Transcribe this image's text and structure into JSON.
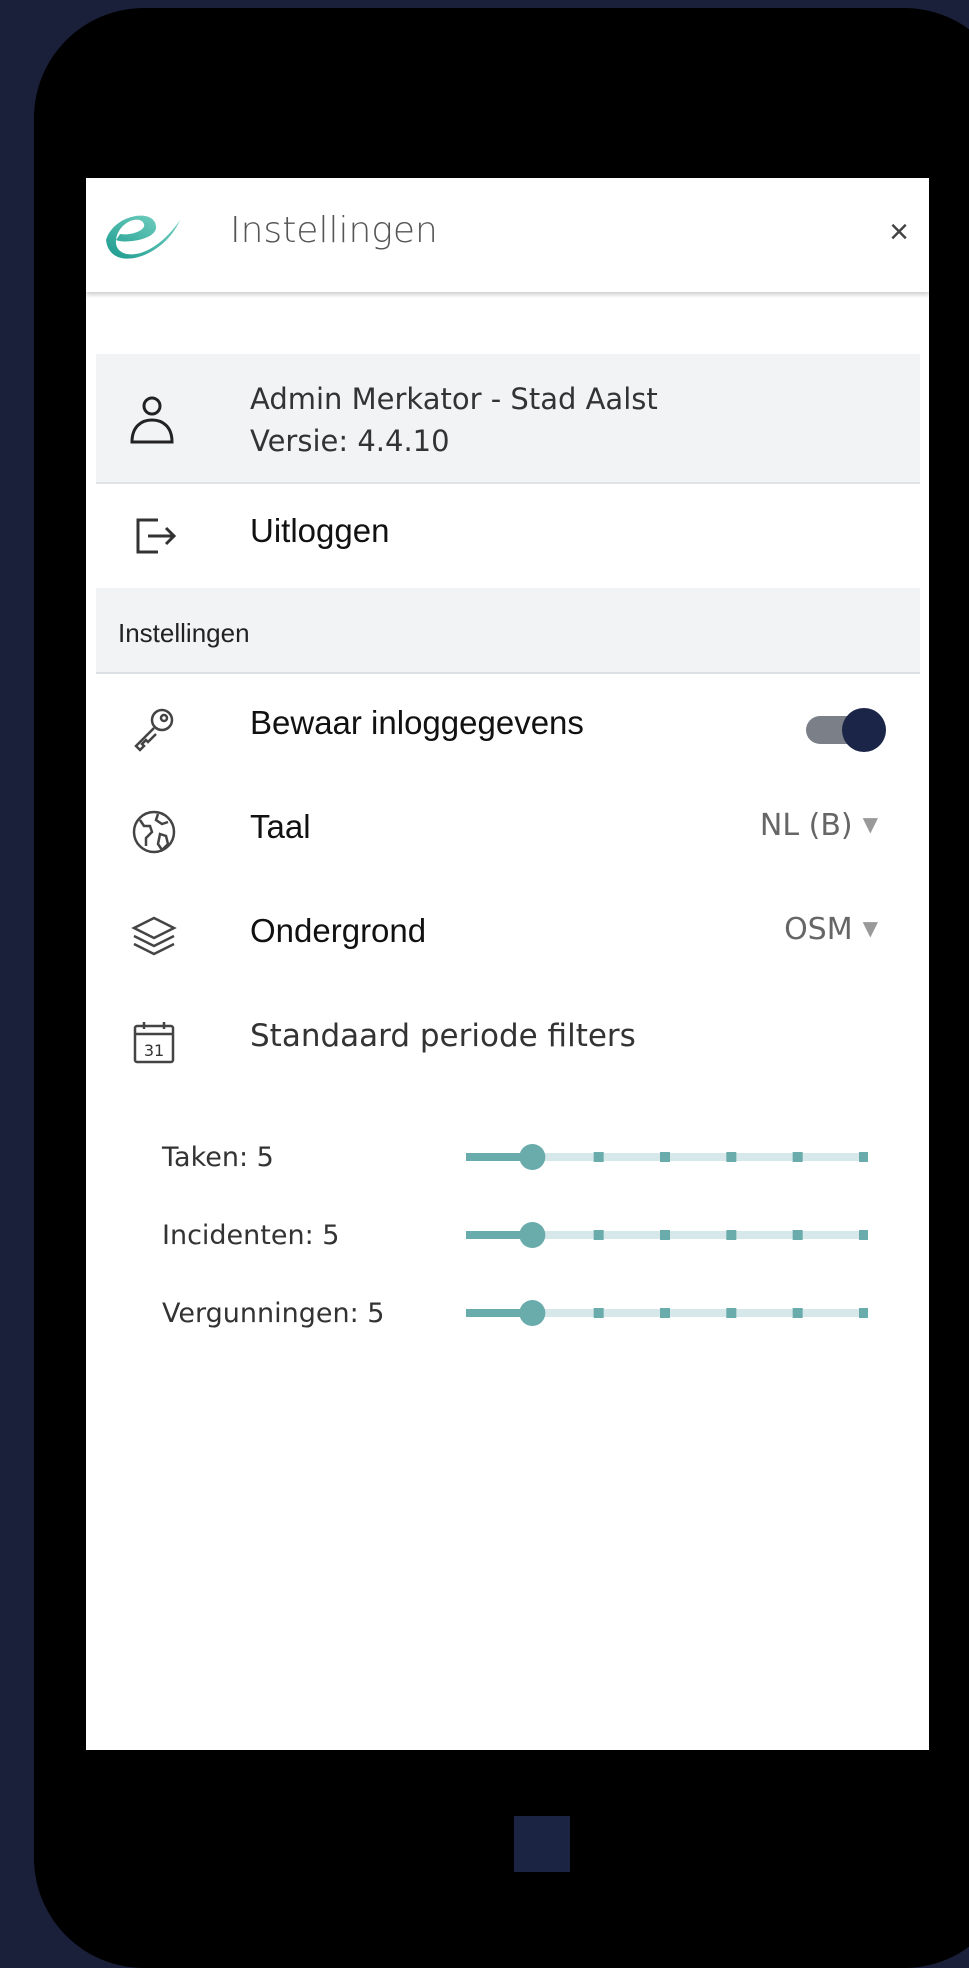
{
  "header": {
    "title": "Instellingen",
    "close_label": "×"
  },
  "profile": {
    "name": "Admin Merkator - Stad Aalst",
    "version": "Versie: 4.4.10"
  },
  "logout": {
    "label": "Uitloggen"
  },
  "section": {
    "label": "Instellingen"
  },
  "settings": {
    "remember": {
      "label": "Bewaar inloggegevens",
      "enabled": true
    },
    "language": {
      "label": "Taal",
      "value": "NL (B)"
    },
    "basemap": {
      "label": "Ondergrond",
      "value": "OSM"
    },
    "period": {
      "label": "Standaard periode filters"
    }
  },
  "calendar_day": "31",
  "sliders": [
    {
      "label": "Taken: 5",
      "value": 5,
      "min": 4,
      "max": 10
    },
    {
      "label": "Incidenten: 5",
      "value": 5,
      "min": 4,
      "max": 10
    },
    {
      "label": "Vergunningen: 5",
      "value": 5,
      "min": 4,
      "max": 10
    }
  ],
  "colors": {
    "accent": "#6aabab",
    "track": "#d6e8ea",
    "navy": "#1b2547",
    "background": "#1a1f3a"
  }
}
